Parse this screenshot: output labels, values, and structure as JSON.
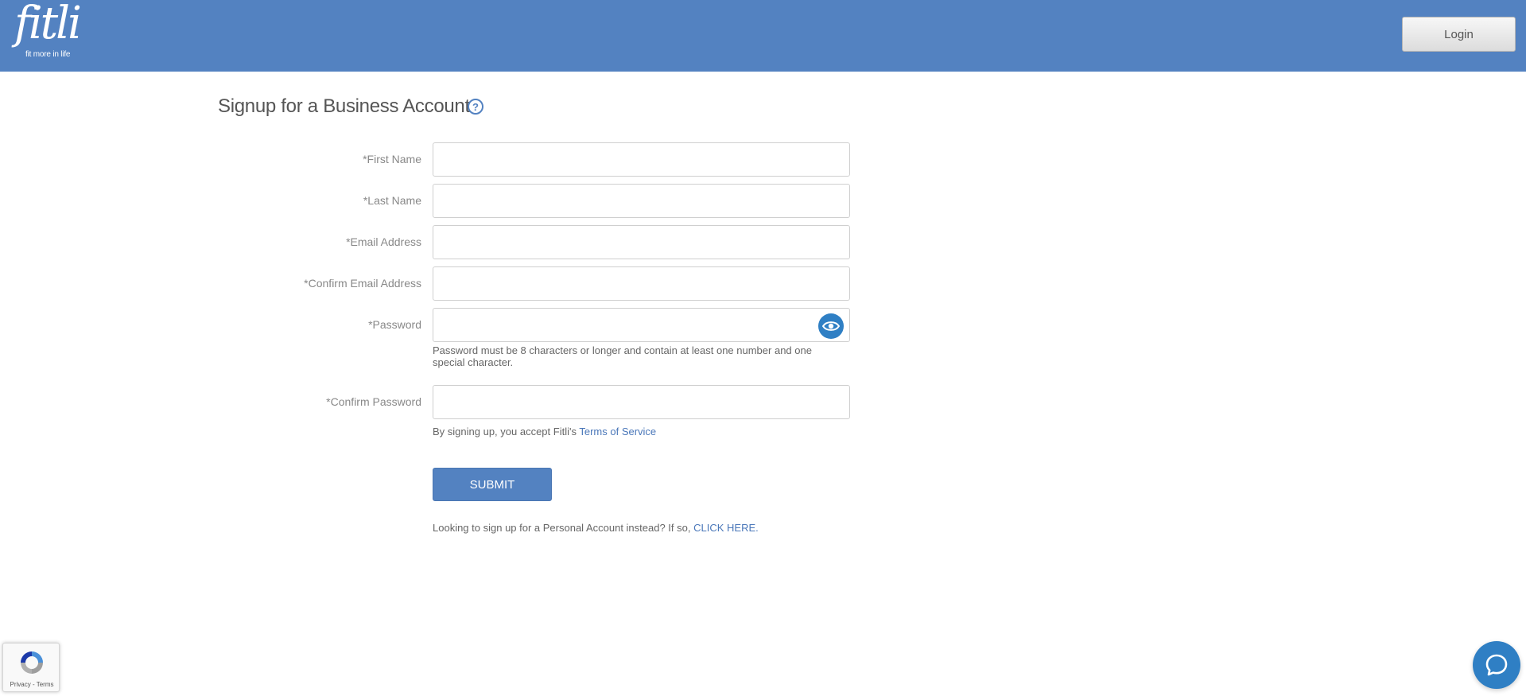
{
  "brand": {
    "logo_text": "fitli",
    "tagline": "fit more in life",
    "header_color": "#5382c1"
  },
  "header": {
    "login_label": "Login"
  },
  "page": {
    "title": "Signup for a Business Account",
    "help_icon": "question-circle-icon"
  },
  "form": {
    "fields": {
      "first_name": {
        "label": "*First Name",
        "value": ""
      },
      "last_name": {
        "label": "*Last Name",
        "value": ""
      },
      "email": {
        "label": "*Email Address",
        "value": ""
      },
      "confirm_email": {
        "label": "*Confirm Email Address",
        "value": ""
      },
      "password": {
        "label": "*Password",
        "value": "",
        "toggle_icon": "eye-icon"
      },
      "confirm_password": {
        "label": "*Confirm Password",
        "value": ""
      }
    },
    "password_hint": "Password must be 8 characters or longer and contain at least one number and one special character.",
    "terms_prefix": "By signing up, you accept Fitli's",
    "terms_link": "Terms of Service",
    "submit_label": "SUBMIT",
    "personal_prefix": "Looking to sign up for a Personal Account instead? If so,",
    "personal_link": "CLICK HERE."
  },
  "recaptcha": {
    "links": "Privacy - Terms"
  },
  "chat": {
    "icon": "chat-bubble-icon",
    "color": "#2f7fc4"
  }
}
